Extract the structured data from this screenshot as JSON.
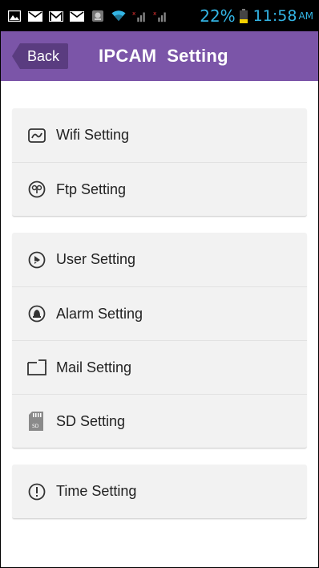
{
  "status_bar": {
    "battery_percent": "22%",
    "time": "11:58",
    "ampm": "AM",
    "text_color": "#33b5e5",
    "icons": [
      "picture-icon",
      "mail-icon",
      "gmail-icon",
      "mail-icon",
      "app-icon",
      "wifi-icon",
      "signal-icon",
      "signal-icon",
      "battery-icon"
    ]
  },
  "header": {
    "back_label": "Back",
    "title": "IPCAM  Setting",
    "bar_color": "#7b55a8"
  },
  "groups": [
    {
      "items": [
        {
          "label": "Wifi Setting",
          "icon": "wifi-setting-icon"
        },
        {
          "label": "Ftp Setting",
          "icon": "ftp-setting-icon"
        }
      ]
    },
    {
      "items": [
        {
          "label": "User Setting",
          "icon": "user-setting-icon"
        },
        {
          "label": "Alarm Setting",
          "icon": "alarm-setting-icon"
        },
        {
          "label": "Mail Setting",
          "icon": "mail-setting-icon"
        },
        {
          "label": "SD Setting",
          "icon": "sd-card-icon"
        }
      ]
    },
    {
      "items": [
        {
          "label": "Time Setting",
          "icon": "time-setting-icon"
        }
      ]
    }
  ]
}
